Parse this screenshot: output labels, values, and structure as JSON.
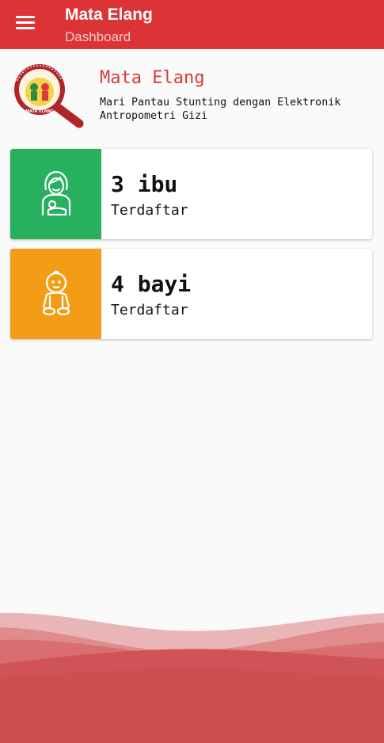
{
  "appbar": {
    "title": "Mata Elang",
    "subtitle": "Dashboard",
    "menu_icon": "hamburger-menu-icon",
    "color": "#dc3336"
  },
  "brand": {
    "name": "Mata Elang",
    "tagline": "Mari Pantau Stunting dengan Elektronik Antropometri Gizi",
    "logo_text_top": "Mari Pantau Stunting",
    "logo_text_bottom": "Mata Elang"
  },
  "cards": [
    {
      "count": "3 ibu",
      "label": "Terdaftar",
      "icon": "mother-icon",
      "color": "#27b15e"
    },
    {
      "count": "4 bayi",
      "label": "Terdaftar",
      "icon": "baby-icon",
      "color": "#f39d16"
    }
  ]
}
